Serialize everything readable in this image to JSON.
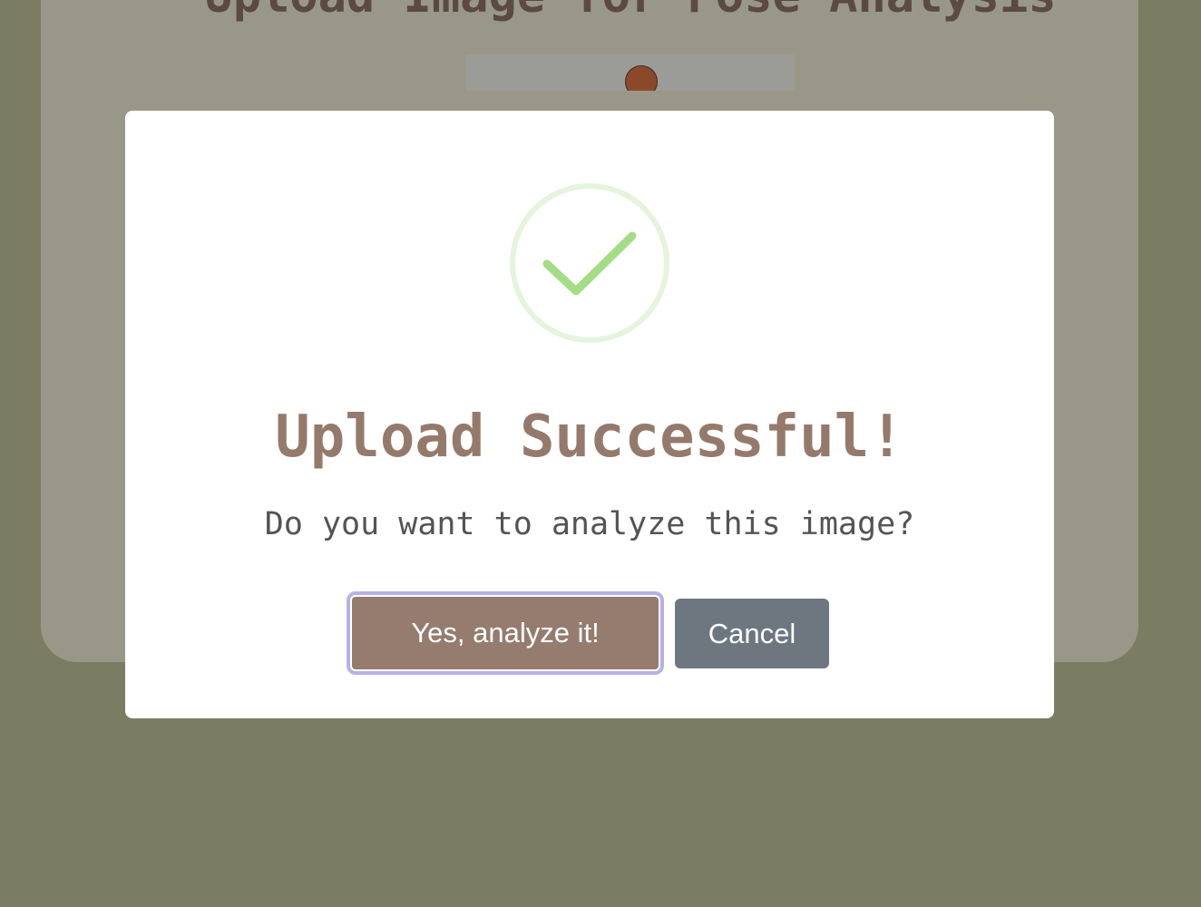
{
  "page": {
    "title": "Upload Image for Pose Analysis"
  },
  "modal": {
    "icon": "check-circle-icon",
    "title": "Upload Successful!",
    "text": "Do you want to analyze this image?",
    "confirm_label": "Yes, analyze it!",
    "cancel_label": "Cancel"
  },
  "colors": {
    "background": "#7b7d63",
    "card": "#999787",
    "title_brown": "#957a6c",
    "confirm_button": "#957c6e",
    "cancel_button": "#6e7780",
    "success_green": "#a5dc86",
    "focus_ring": "#b6b1e6"
  }
}
